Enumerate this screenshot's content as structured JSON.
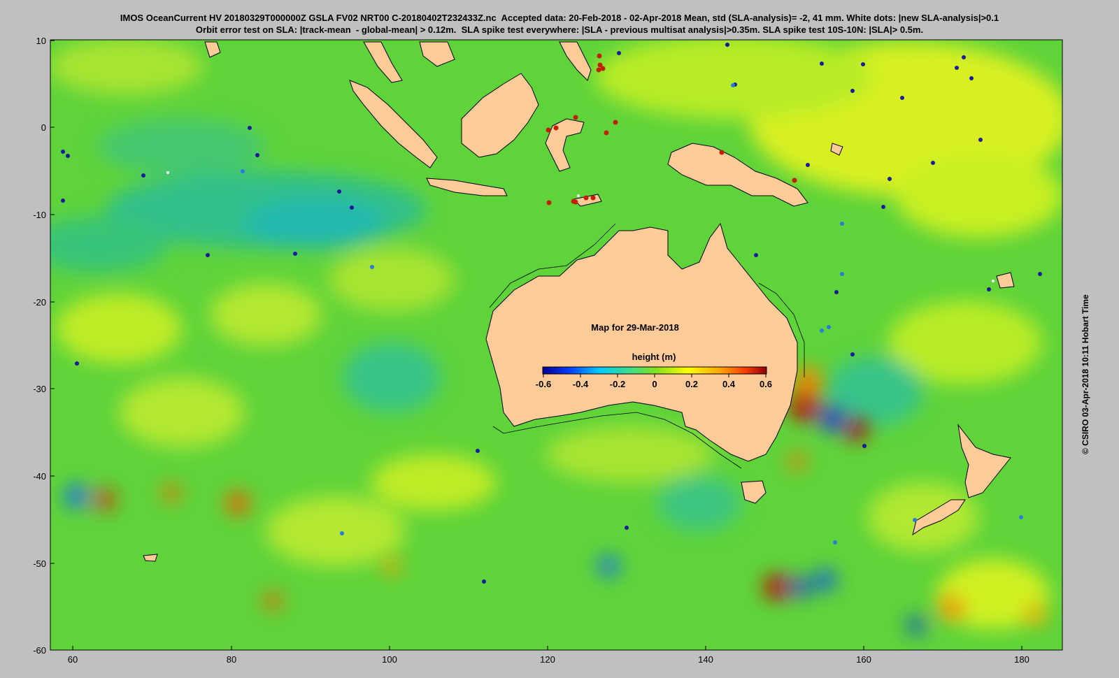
{
  "header": {
    "line1": "IMOS OceanCurrent HV 20180329T000000Z GSLA FV02 NRT00 C-20180402T232433Z.nc  Accepted data: 20-Feb-2018 - 02-Apr-2018 Mean, std (SLA-analysis)= -2, 41 mm. White dots: |new SLA-analysis|>0.1",
    "line2": "Orbit error test on SLA: |track-mean  - global-mean| > 0.12m.  SLA spike test everywhere: |SLA - previous multisat analysis|>0.35m. SLA spike test 10S-10N: |SLA|> 0.5m."
  },
  "map": {
    "caption": "Map for 29-Mar-2018",
    "lon_ticks": [
      "60",
      "80",
      "100",
      "120",
      "140",
      "160",
      "180"
    ],
    "lat_ticks": [
      "10",
      "0",
      "-10",
      "-20",
      "-30",
      "-40",
      "-50",
      "-60"
    ],
    "lon_range": [
      57,
      185
    ],
    "lat_range": [
      -60,
      10
    ],
    "land_color": "#ffcc99",
    "ocean_base_color": "#5fd33a"
  },
  "colorbar": {
    "title": "height (m)",
    "tick_labels": [
      "-0.6",
      "-0.4",
      "-0.2",
      "0",
      "0.2",
      "0.4",
      "0.6"
    ],
    "range": [
      -0.6,
      0.6
    ],
    "colors": [
      "#00008f",
      "#0040ff",
      "#00c8ff",
      "#40e080",
      "#7fe020",
      "#ffff00",
      "#ffa000",
      "#ff4000",
      "#8f0000"
    ]
  },
  "credit": "© CSIRO 03-Apr-2018 10:11 Hobart Time"
}
